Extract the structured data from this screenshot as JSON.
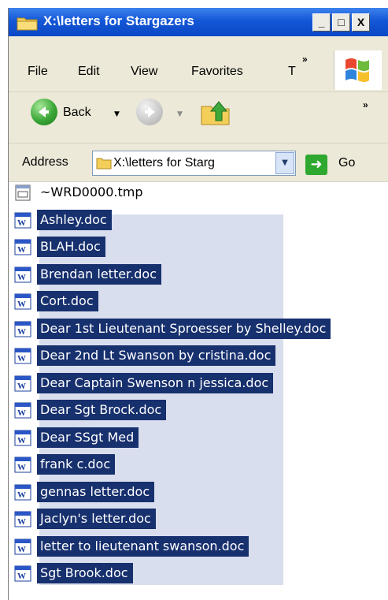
{
  "window": {
    "title": "X:\\letters for Stargazers",
    "controls": {
      "minimize": "_",
      "maximize": "□",
      "close": "X"
    }
  },
  "menubar": {
    "items": [
      "File",
      "Edit",
      "View",
      "Favorites",
      "T"
    ],
    "overflow": "»"
  },
  "toolbar": {
    "back_label": "Back",
    "overflow": "»"
  },
  "address": {
    "label": "Address",
    "value": "X:\\letters for Starg",
    "go_label": "Go"
  },
  "files": [
    {
      "name": "~WRD0000.tmp",
      "icon": "tmp-file-icon",
      "selected": false
    },
    {
      "name": "Ashley.doc",
      "icon": "word-doc-icon",
      "selected": true
    },
    {
      "name": "BLAH.doc",
      "icon": "word-doc-icon",
      "selected": true
    },
    {
      "name": "Brendan                      letter.doc",
      "icon": "word-doc-icon",
      "selected": true
    },
    {
      "name": "Cort.doc",
      "icon": "word-doc-icon",
      "selected": true
    },
    {
      "name": "Dear 1st Lieutenant Sproesser by Shelley.doc",
      "icon": "word-doc-icon",
      "selected": true
    },
    {
      "name": "Dear 2nd Lt Swanson by cristina.doc",
      "icon": "word-doc-icon",
      "selected": true
    },
    {
      "name": "Dear Captain      Swenson n jessica.doc",
      "icon": "word-doc-icon",
      "selected": true
    },
    {
      "name": "Dear Sgt Brock.doc",
      "icon": "word-doc-icon",
      "selected": true
    },
    {
      "name": "Dear SSgt Med                   ",
      "icon": "word-doc-icon",
      "selected": true
    },
    {
      "name": "frank c.doc",
      "icon": "word-doc-icon",
      "selected": true
    },
    {
      "name": "gennas letter.doc",
      "icon": "word-doc-icon",
      "selected": true
    },
    {
      "name": "Jaclyn's letter.doc",
      "icon": "word-doc-icon",
      "selected": true
    },
    {
      "name": "letter to lieutenant swanson.doc",
      "icon": "word-doc-icon",
      "selected": true
    },
    {
      "name": "Sgt Brook.doc",
      "icon": "word-doc-icon",
      "selected": true
    }
  ],
  "colors": {
    "titlebar": "#0a47c6",
    "selection": "#17306e",
    "selection_area": "#d9deee",
    "chrome": "#ece9d8"
  }
}
